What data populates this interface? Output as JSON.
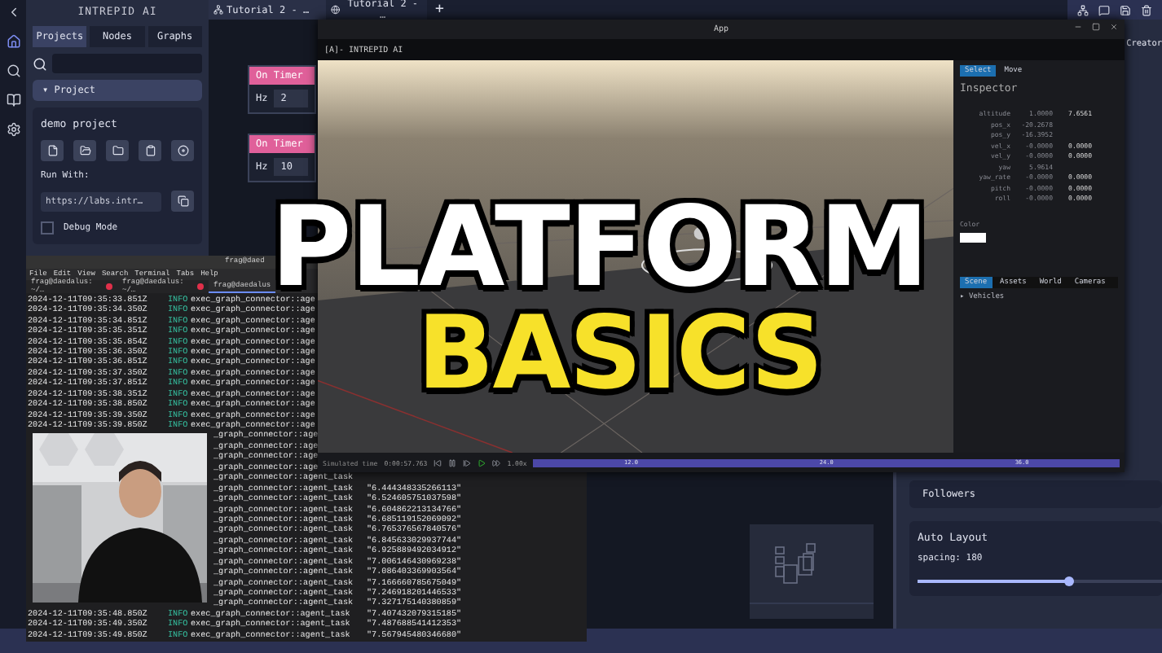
{
  "nav": [
    {
      "kind": "back",
      "selected": false
    },
    {
      "kind": "home",
      "selected": true
    },
    {
      "kind": "search",
      "selected": false
    },
    {
      "kind": "book",
      "selected": false
    },
    {
      "kind": "settings",
      "selected": false
    }
  ],
  "sidebar": {
    "title": "INTREPID AI",
    "tabs": [
      {
        "label": "Projects",
        "selected": true
      },
      {
        "label": "Nodes",
        "selected": false
      },
      {
        "label": "Graphs",
        "selected": false
      }
    ],
    "section": {
      "marker": "▾",
      "label": "Project"
    },
    "project": {
      "name": "demo project",
      "run_with": "Run With:",
      "url": "https://labs.intr…",
      "debug": {
        "label": "Debug Mode",
        "checked": false
      }
    }
  },
  "editor_tabs": [
    {
      "label": "Tutorial 2 - …",
      "kind": "graph",
      "selected": true
    },
    {
      "label": "Tutorial 2 - …",
      "kind": "web",
      "selected": false
    }
  ],
  "new_tab": "+",
  "nodes": [
    {
      "title": "On Timer",
      "port": "Hz",
      "value": "2"
    },
    {
      "title": "On Timer",
      "port": "Hz",
      "value": "10"
    }
  ],
  "right_panel": {
    "title": "Creator",
    "followers": "Followers",
    "auto_layout": {
      "title": "Auto Layout",
      "spacing": "spacing: 180",
      "level": 0.62
    }
  },
  "app_window": {
    "title": "App",
    "brand": "[A]- INTREPID AI",
    "inspector": {
      "tabs": [
        {
          "label": "Select",
          "selected": true
        },
        {
          "label": "Move",
          "selected": false
        }
      ],
      "title": "Inspector",
      "rows": [
        {
          "label": "altitude",
          "value": "1.0000",
          "value_2": "7.6561"
        },
        {
          "label": "pos_x",
          "value": "-20.2678"
        },
        {
          "label": "pos_y",
          "value": "-16.3952"
        },
        {
          "label": "vel_x",
          "value": "-0.0000",
          "value_2": "0.0000"
        },
        {
          "label": "vel_y",
          "value": "-0.0000",
          "value_2": "0.0000"
        },
        {
          "label": "yaw",
          "value": "5.9614"
        },
        {
          "label": "yaw_rate",
          "value": "-0.0000",
          "value_2": "0.0000"
        },
        {
          "label": "pitch",
          "value": "-0.0000",
          "value_2": "0.0000"
        },
        {
          "label": "roll",
          "value": "-0.0000",
          "value_2": "0.0000"
        }
      ],
      "color_label": "Color",
      "bottom_tabs": [
        {
          "label": "Scene",
          "selected": true
        },
        {
          "label": "Assets",
          "selected": false
        },
        {
          "label": "World",
          "selected": false
        },
        {
          "label": "Cameras",
          "selected": false
        }
      ],
      "tree": [
        {
          "marker": "▸",
          "label": "Vehicles"
        }
      ]
    },
    "timeline": {
      "label": "Simulated time",
      "time": "0:00:57.763",
      "speed": "1.00x",
      "ticks": [
        "12.0",
        "24.0",
        "36.0"
      ]
    }
  },
  "terminal": {
    "title": "frag@daed",
    "menu": [
      "File",
      "Edit",
      "View",
      "Search",
      "Terminal",
      "Tabs",
      "Help"
    ],
    "tabs": [
      {
        "label": "frag@daedalus: ~/…",
        "selected": false
      },
      {
        "label": "frag@daedalus: ~/…",
        "selected": false
      },
      {
        "label": "frag@daedalus",
        "selected": true
      }
    ],
    "rows": [
      {
        "time": "2024-12-11T09:35:33.851Z",
        "level": "INFO",
        "source": "exec_graph_connector::age"
      },
      {
        "time": "2024-12-11T09:35:34.350Z",
        "level": "INFO",
        "source": "exec_graph_connector::age"
      },
      {
        "time": "2024-12-11T09:35:34.851Z",
        "level": "INFO",
        "source": "exec_graph_connector::age"
      },
      {
        "time": "2024-12-11T09:35:35.351Z",
        "level": "INFO",
        "source": "exec_graph_connector::age"
      },
      {
        "time": "2024-12-11T09:35:35.854Z",
        "level": "INFO",
        "source": "exec_graph_connector::age"
      },
      {
        "time": "2024-12-11T09:35:36.350Z",
        "level": "INFO",
        "source": "exec_graph_connector::age"
      },
      {
        "time": "2024-12-11T09:35:36.851Z",
        "level": "INFO",
        "source": "exec_graph_connector::age"
      },
      {
        "time": "2024-12-11T09:35:37.350Z",
        "level": "INFO",
        "source": "exec_graph_connector::age"
      },
      {
        "time": "2024-12-11T09:35:37.851Z",
        "level": "INFO",
        "source": "exec_graph_connector::age"
      },
      {
        "time": "2024-12-11T09:35:38.351Z",
        "level": "INFO",
        "source": "exec_graph_connector::age"
      },
      {
        "time": "2024-12-11T09:35:38.850Z",
        "level": "INFO",
        "source": "exec_graph_connector::age"
      },
      {
        "time": "2024-12-11T09:35:39.350Z",
        "level": "INFO",
        "source": "exec_graph_connector::age"
      },
      {
        "time": "2024-12-11T09:35:39.850Z",
        "level": "INFO",
        "source": "exec_graph_connector::age"
      },
      {
        "source": "_graph_connector::age"
      },
      {
        "source": "_graph_connector::age"
      },
      {
        "source": "_graph_connector::age"
      },
      {
        "source": "_graph_connector::age"
      },
      {
        "source": "_graph_connector::agent_task"
      },
      {
        "source": "_graph_connector::agent_task",
        "value": "\"6.444348335266113\""
      },
      {
        "source": "_graph_connector::agent_task",
        "value": "\"6.524605751037598\""
      },
      {
        "source": "_graph_connector::agent_task",
        "value": "\"6.604862213134766\""
      },
      {
        "source": "_graph_connector::agent_task",
        "value": "\"6.685119152069092\""
      },
      {
        "source": "_graph_connector::agent_task",
        "value": "\"6.765376567840576\""
      },
      {
        "source": "_graph_connector::agent_task",
        "value": "\"6.845633029937744\""
      },
      {
        "source": "_graph_connector::agent_task",
        "value": "\"6.925889492034912\""
      },
      {
        "source": "_graph_connector::agent_task",
        "value": "\"7.006146430969238\""
      },
      {
        "source": "_graph_connector::agent_task",
        "value": "\"7.086403369903564\""
      },
      {
        "source": "_graph_connector::agent_task",
        "value": "\"7.166660785675049\""
      },
      {
        "source": "_graph_connector::agent_task",
        "value": "\"7.246918201446533\""
      },
      {
        "source": "_graph_connector::agent_task",
        "value": "\"7.327175140380859\""
      },
      {
        "time": "2024-12-11T09:35:48.850Z",
        "level": "INFO",
        "source": "exec_graph_connector::agent_task",
        "value": "\"7.407432079315185\""
      },
      {
        "time": "2024-12-11T09:35:49.350Z",
        "level": "INFO",
        "source": "exec_graph_connector::agent_task",
        "value": "\"7.487688541412353\""
      },
      {
        "time": "2024-12-11T09:35:49.850Z",
        "level": "INFO",
        "source": "exec_graph_connector::agent_task",
        "value": "\"7.567945480346680\""
      }
    ]
  },
  "headline": {
    "line_1": "PLATFORM",
    "line_2": "BASICS"
  }
}
